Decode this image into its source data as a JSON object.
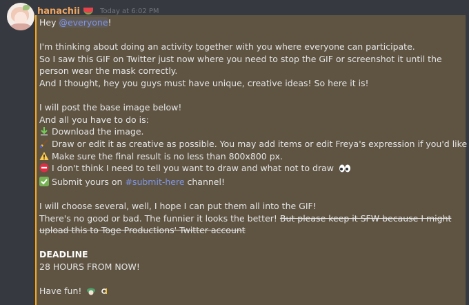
{
  "author": {
    "username": "hanachii",
    "timestamp": "Today at 6:02 PM"
  },
  "message": {
    "greeting_prefix": "Hey ",
    "mention": "@everyone",
    "greeting_suffix": "!",
    "p1_line1": "I'm thinking about doing an activity together with you where everyone can participate.",
    "p1_line2": "So I saw this GIF on Twitter just now where you need to stop the GIF or screenshot it until the person wear the mask correctly.",
    "p1_line3": "And I thought, hey you guys must have unique, creative ideas! So here it is!",
    "p2_line1": "I will post the base image below!",
    "p2_line2": "And all you have to do is:",
    "step_download": "Download the image.",
    "step_draw": "Draw or edit it as creative as possible. You may add items or edit Freya's expression if you'd like to.",
    "step_size": "Make sure the final result is no less than 800x800 px.",
    "step_rules": "I don't think I need to tell you want to draw and what not to draw",
    "step_submit_prefix": "Submit yours on ",
    "submit_channel": "#submit-here",
    "step_submit_suffix": " channel!",
    "p3_line1": "I will choose several, well, I hope I can put them all into the GIF!",
    "p3_line2_plain": "There's no good or bad. The funnier it looks the better! ",
    "p3_line2_strike": "But please keep it SFW because I might upload this to Toge Productions' Twitter account",
    "deadline_title": "DEADLINE",
    "deadline_value": "28 HOURS FROM NOW!",
    "closing": "Have fun!"
  },
  "icons": {
    "download": "arrow-down-icon",
    "draw": "paintbrush-icon",
    "size": "warning-icon",
    "rules": "no-entry-icon",
    "submit": "check-mark-icon"
  },
  "colors": {
    "background": "#36393f",
    "highlight": "#5f5442",
    "highlight_border": "#faa81a",
    "username": "#f0a55f",
    "mention": "#7e95e6"
  }
}
